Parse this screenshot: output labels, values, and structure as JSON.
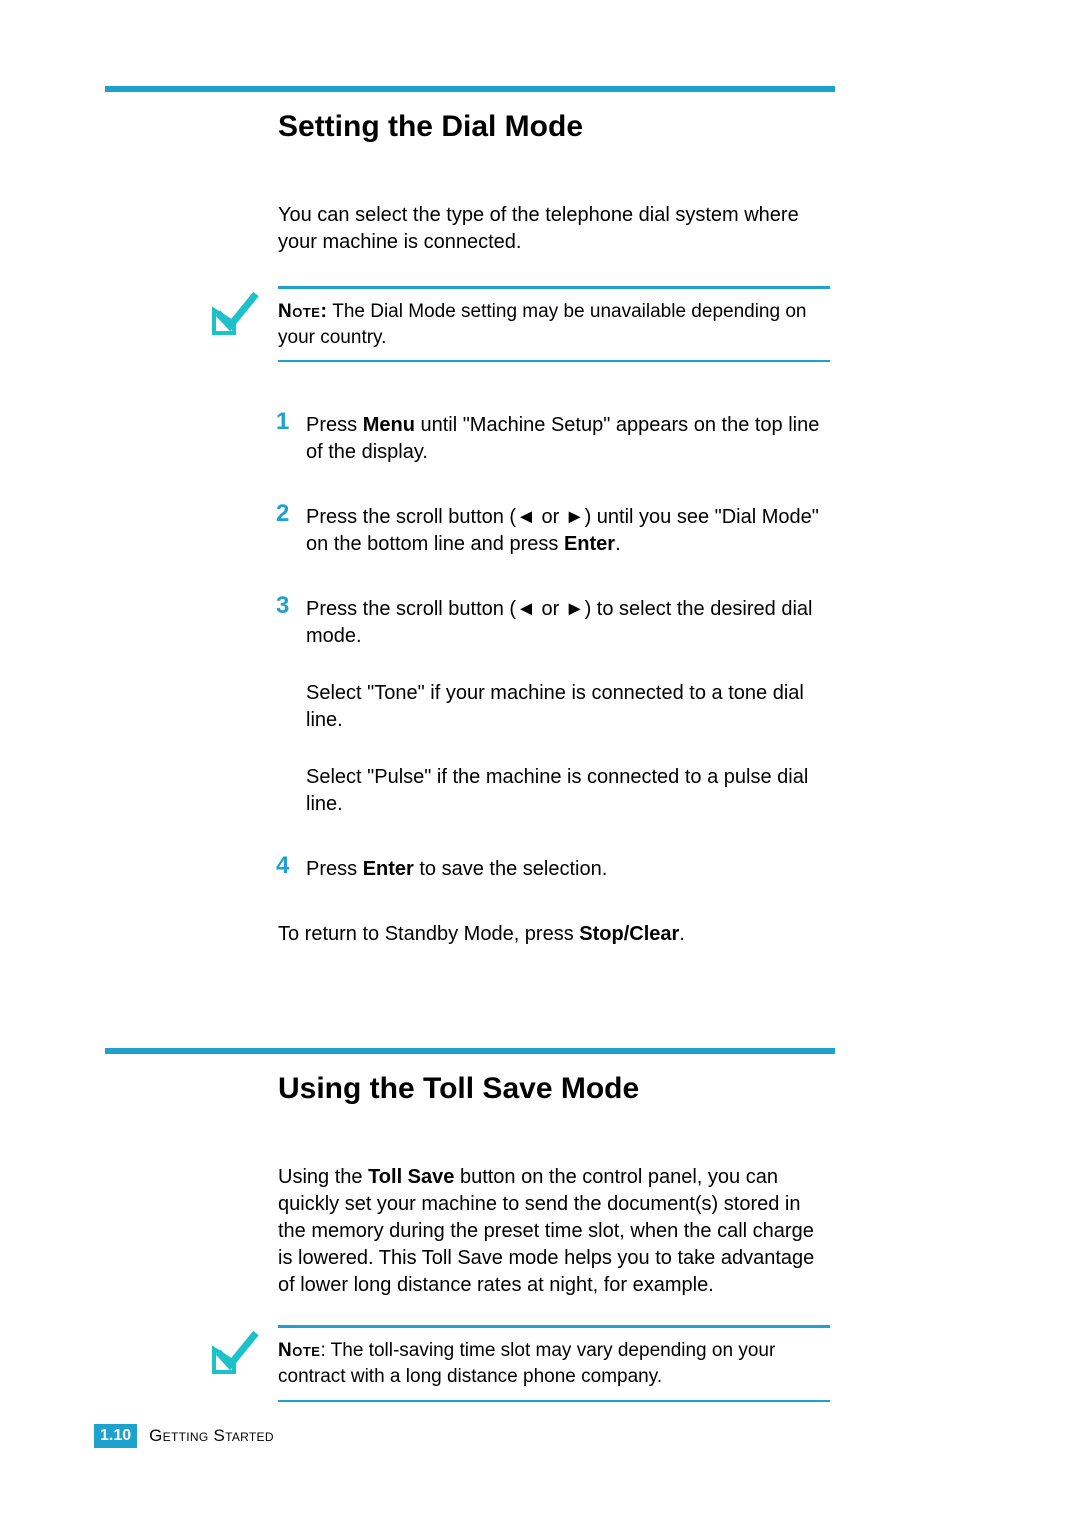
{
  "section1": {
    "title": "Setting the Dial Mode",
    "intro": "You can select the type of the telephone dial system where your machine is connected.",
    "note_label": "Note:",
    "note_text": " The Dial Mode setting may be unavailable depending on your country.",
    "steps": [
      {
        "num": "1",
        "text_pre": "Press ",
        "bold1": "Menu",
        "text_post": " until \"Machine Setup\" appears on the top line of the display."
      },
      {
        "num": "2",
        "text_pre": "Press the scroll button (◄ or ►) until you see \"Dial Mode\" on the bottom line and press ",
        "bold1": "Enter",
        "text_post": "."
      },
      {
        "num": "3",
        "text_pre": "Press the scroll button (◄ or ►) to select the desired dial mode.",
        "bold1": "",
        "text_post": "",
        "sub1": "Select \"Tone\" if your machine is connected to a tone dial line.",
        "sub2": "Select \"Pulse\" if the machine is connected to a pulse dial line."
      },
      {
        "num": "4",
        "text_pre": "Press ",
        "bold1": "Enter",
        "text_post": " to save the selection."
      }
    ],
    "return_pre": "To return to Standby Mode, press ",
    "return_bold": "Stop/Clear",
    "return_post": "."
  },
  "section2": {
    "title": "Using the Toll Save Mode",
    "intro_pre": "Using the ",
    "intro_bold": "Toll Save",
    "intro_post": " button on the control panel, you can quickly set your machine to send the document(s) stored in the memory during the preset time slot, when the call charge is lowered. This Toll Save mode helps you to take advantage of lower long distance rates at night, for example.",
    "note_label": "Note",
    "note_text": ": The toll-saving time slot may vary depending on your contract with a long distance phone company."
  },
  "footer": {
    "page_number": "1.10",
    "chapter": "Getting Started"
  }
}
